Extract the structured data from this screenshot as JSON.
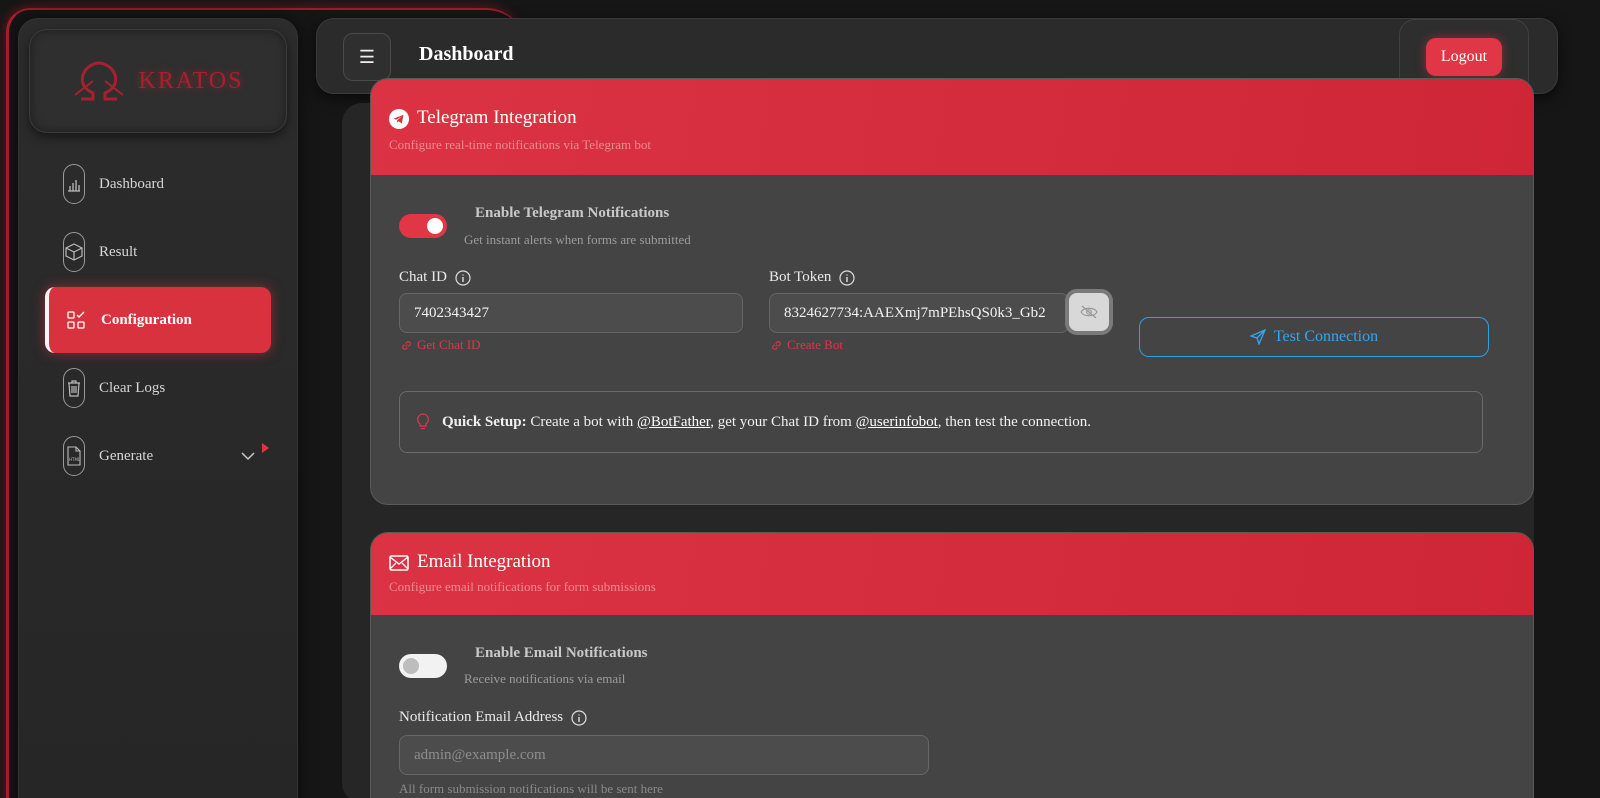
{
  "brand": {
    "name": "KRATOS",
    "accent": "#d9323f"
  },
  "sidebar": {
    "items": [
      {
        "label": "Dashboard",
        "icon": "bar-chart-icon",
        "active": false
      },
      {
        "label": "Result",
        "icon": "cube-icon",
        "active": false
      },
      {
        "label": "Configuration",
        "icon": "grid-check-icon",
        "active": true
      },
      {
        "label": "Clear Logs",
        "icon": "trash-icon",
        "active": false
      },
      {
        "label": "Generate",
        "icon": "html-file-icon",
        "active": false
      }
    ]
  },
  "header": {
    "title": "Dashboard",
    "logout_label": "Logout",
    "menu_icon": "☰"
  },
  "telegram": {
    "title": "Telegram Integration",
    "subtitle": "Configure real-time notifications via Telegram bot",
    "toggle_label": "Enable Telegram Notifications",
    "toggle_sub": "Get instant alerts when forms are submitted",
    "enabled": true,
    "chat_id_label": "Chat ID",
    "chat_id_value": "7402343427",
    "get_chat_id_link": "Get Chat ID",
    "bot_token_label": "Bot Token",
    "bot_token_value": "8324627734:AAEXmj7mPEhsQS0k3_Gb2",
    "create_bot_link": "Create Bot",
    "test_button": "Test Connection",
    "quick_setup": {
      "bold": "Quick Setup:",
      "t1": " Create a bot with ",
      "link1": "@BotFather",
      "t2": ", get your Chat ID from ",
      "link2": "@userinfobot",
      "t3": ", then test the connection."
    }
  },
  "email": {
    "title": "Email Integration",
    "subtitle": "Configure email notifications for form submissions",
    "toggle_label": "Enable Email Notifications",
    "toggle_sub": "Receive notifications via email",
    "enabled": false,
    "address_label": "Notification Email Address",
    "address_placeholder": "admin@example.com",
    "hint": "All form submission notifications will be sent here"
  }
}
